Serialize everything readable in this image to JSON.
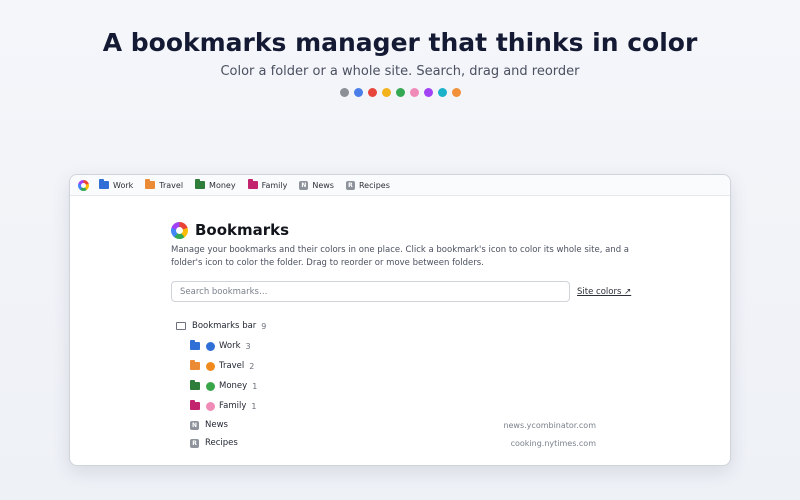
{
  "hero": {
    "title": "A bookmarks manager that thinks in color",
    "subtitle": "Color a folder or a whole site. Search, drag and reorder",
    "palette": [
      "#8c8f96",
      "#4a7ee8",
      "#e8453c",
      "#f2b31d",
      "#34a853",
      "#f08bb8",
      "#a142f4",
      "#1ab1c9",
      "#f2913a"
    ]
  },
  "bookmarks_bar": {
    "items": [
      {
        "label": "Work",
        "kind": "folder",
        "color": "#2f6fd6"
      },
      {
        "label": "Travel",
        "kind": "folder",
        "color": "#ec8b35"
      },
      {
        "label": "Money",
        "kind": "folder",
        "color": "#2e7d3a"
      },
      {
        "label": "Family",
        "kind": "folder",
        "color": "#c2246e"
      },
      {
        "label": "News",
        "kind": "site",
        "letter": "N"
      },
      {
        "label": "Recipes",
        "kind": "site",
        "letter": "R"
      }
    ]
  },
  "panel": {
    "title": "Bookmarks",
    "description": "Manage your bookmarks and their colors in one place. Click a bookmark's icon to color its whole site, and a folder's icon to color the folder. Drag to reorder or move between folders.",
    "search_placeholder": "Search bookmarks…",
    "site_colors_link": "Site colors ↗"
  },
  "tree": {
    "root": {
      "label": "Bookmarks bar",
      "count": "9"
    },
    "folders": [
      {
        "label": "Work",
        "count": "3",
        "color": "#2f6fd6",
        "dot": "#2f6fd6"
      },
      {
        "label": "Travel",
        "count": "2",
        "color": "#ec8b35",
        "dot": "#f08a1e"
      },
      {
        "label": "Money",
        "count": "1",
        "color": "#2e7d3a",
        "dot": "#3aa64a"
      },
      {
        "label": "Family",
        "count": "1",
        "color": "#c2246e",
        "dot": "#f08bb8"
      }
    ],
    "sites": [
      {
        "label": "News",
        "letter": "N",
        "url": "news.ycombinator.com"
      },
      {
        "label": "Recipes",
        "letter": "R",
        "url": "cooking.nytimes.com"
      }
    ]
  }
}
